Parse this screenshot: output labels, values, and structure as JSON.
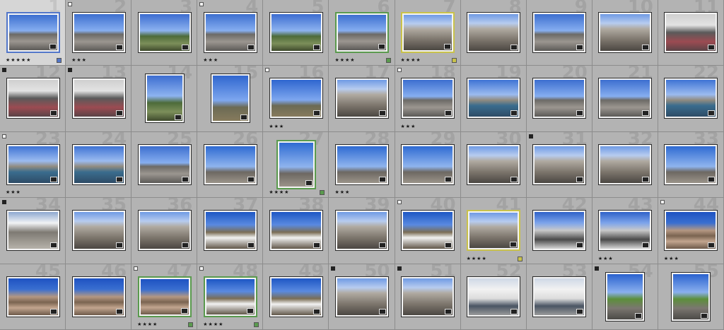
{
  "colors": {
    "grid_background": "#8f8f8f",
    "cell_background": "#b3b3b3",
    "cell_selected": "#d6d6d6",
    "label_green": "#5a9a4e",
    "label_yellow": "#c9c24a",
    "label_blue": "#5276c9"
  },
  "cells": [
    {
      "num": "1",
      "scene": "sky-town",
      "stars": "★★★★★",
      "flag": "none",
      "label": "blue",
      "orient": "landscape",
      "selected": true
    },
    {
      "num": "2",
      "scene": "sky-town",
      "stars": "★★★",
      "flag": "pick",
      "label": "none",
      "orient": "landscape"
    },
    {
      "num": "3",
      "scene": "sky-green",
      "stars": "",
      "flag": "none",
      "label": "none",
      "orient": "landscape"
    },
    {
      "num": "4",
      "scene": "sky-town",
      "stars": "★★★",
      "flag": "pick",
      "label": "none",
      "orient": "landscape"
    },
    {
      "num": "5",
      "scene": "sky-green",
      "stars": "",
      "flag": "none",
      "label": "none",
      "orient": "landscape"
    },
    {
      "num": "6",
      "scene": "sky-town",
      "stars": "★★★★",
      "flag": "none",
      "label": "green",
      "orient": "landscape"
    },
    {
      "num": "7",
      "scene": "buildings",
      "stars": "★★★★",
      "flag": "none",
      "label": "yellow",
      "orient": "landscape"
    },
    {
      "num": "8",
      "scene": "buildings",
      "stars": "",
      "flag": "none",
      "label": "none",
      "orient": "landscape"
    },
    {
      "num": "9",
      "scene": "sky-town",
      "stars": "",
      "flag": "none",
      "label": "none",
      "orient": "landscape"
    },
    {
      "num": "10",
      "scene": "buildings",
      "stars": "",
      "flag": "none",
      "label": "none",
      "orient": "landscape"
    },
    {
      "num": "11",
      "scene": "garage",
      "stars": "",
      "flag": "none",
      "label": "none",
      "orient": "landscape"
    },
    {
      "num": "12",
      "scene": "garage",
      "stars": "",
      "flag": "reject",
      "label": "none",
      "orient": "landscape"
    },
    {
      "num": "13",
      "scene": "garage",
      "stars": "",
      "flag": "reject",
      "label": "none",
      "orient": "landscape"
    },
    {
      "num": "14",
      "scene": "sky-green",
      "stars": "",
      "flag": "none",
      "label": "none",
      "orient": "portrait"
    },
    {
      "num": "15",
      "scene": "tower",
      "stars": "",
      "flag": "none",
      "label": "none",
      "orient": "portrait"
    },
    {
      "num": "16",
      "scene": "tower",
      "stars": "★★★",
      "flag": "pick",
      "label": "none",
      "orient": "landscape"
    },
    {
      "num": "17",
      "scene": "buildings",
      "stars": "",
      "flag": "none",
      "label": "none",
      "orient": "landscape"
    },
    {
      "num": "18",
      "scene": "sky-town",
      "stars": "★★★",
      "flag": "pick",
      "label": "none",
      "orient": "landscape"
    },
    {
      "num": "19",
      "scene": "harbor",
      "stars": "",
      "flag": "none",
      "label": "none",
      "orient": "landscape"
    },
    {
      "num": "20",
      "scene": "sky-town",
      "stars": "",
      "flag": "none",
      "label": "none",
      "orient": "landscape"
    },
    {
      "num": "21",
      "scene": "sky-town",
      "stars": "",
      "flag": "none",
      "label": "none",
      "orient": "landscape"
    },
    {
      "num": "22",
      "scene": "harbor",
      "stars": "",
      "flag": "none",
      "label": "none",
      "orient": "landscape"
    },
    {
      "num": "23",
      "scene": "harbor",
      "stars": "★★★",
      "flag": "pick",
      "label": "none",
      "orient": "landscape"
    },
    {
      "num": "24",
      "scene": "harbor",
      "stars": "",
      "flag": "none",
      "label": "none",
      "orient": "landscape"
    },
    {
      "num": "25",
      "scene": "sky-town",
      "stars": "",
      "flag": "none",
      "label": "none",
      "orient": "landscape"
    },
    {
      "num": "26",
      "scene": "crane",
      "stars": "",
      "flag": "none",
      "label": "none",
      "orient": "landscape"
    },
    {
      "num": "27",
      "scene": "crane",
      "stars": "★★★★",
      "flag": "none",
      "label": "green",
      "orient": "portrait"
    },
    {
      "num": "28",
      "scene": "crane",
      "stars": "★★★",
      "flag": "none",
      "label": "none",
      "orient": "landscape"
    },
    {
      "num": "29",
      "scene": "crane",
      "stars": "",
      "flag": "none",
      "label": "none",
      "orient": "landscape"
    },
    {
      "num": "30",
      "scene": "buildings",
      "stars": "",
      "flag": "none",
      "label": "none",
      "orient": "landscape"
    },
    {
      "num": "31",
      "scene": "buildings",
      "stars": "",
      "flag": "reject",
      "label": "none",
      "orient": "landscape"
    },
    {
      "num": "32",
      "scene": "buildings",
      "stars": "",
      "flag": "none",
      "label": "none",
      "orient": "landscape"
    },
    {
      "num": "33",
      "scene": "crane",
      "stars": "",
      "flag": "none",
      "label": "none",
      "orient": "landscape"
    },
    {
      "num": "34",
      "scene": "carpark",
      "stars": "",
      "flag": "reject",
      "label": "none",
      "orient": "landscape"
    },
    {
      "num": "35",
      "scene": "buildings",
      "stars": "",
      "flag": "none",
      "label": "none",
      "orient": "landscape"
    },
    {
      "num": "36",
      "scene": "buildings",
      "stars": "",
      "flag": "none",
      "label": "none",
      "orient": "landscape"
    },
    {
      "num": "37",
      "scene": "shed",
      "stars": "",
      "flag": "none",
      "label": "none",
      "orient": "landscape"
    },
    {
      "num": "38",
      "scene": "shed",
      "stars": "",
      "flag": "none",
      "label": "none",
      "orient": "landscape"
    },
    {
      "num": "39",
      "scene": "buildings",
      "stars": "",
      "flag": "none",
      "label": "none",
      "orient": "landscape"
    },
    {
      "num": "40",
      "scene": "shed",
      "stars": "",
      "flag": "pick",
      "label": "none",
      "orient": "landscape"
    },
    {
      "num": "41",
      "scene": "buildings",
      "stars": "★★★★",
      "flag": "none",
      "label": "yellow",
      "orient": "landscape"
    },
    {
      "num": "42",
      "scene": "rails",
      "stars": "",
      "flag": "none",
      "label": "none",
      "orient": "landscape"
    },
    {
      "num": "43",
      "scene": "rails",
      "stars": "★★★",
      "flag": "none",
      "label": "none",
      "orient": "landscape"
    },
    {
      "num": "44",
      "scene": "slats",
      "stars": "★★★",
      "flag": "pick",
      "label": "none",
      "orient": "landscape"
    },
    {
      "num": "45",
      "scene": "slats",
      "stars": "",
      "flag": "none",
      "label": "none",
      "orient": "landscape"
    },
    {
      "num": "46",
      "scene": "slats",
      "stars": "",
      "flag": "none",
      "label": "none",
      "orient": "landscape"
    },
    {
      "num": "47",
      "scene": "slats",
      "stars": "★★★★",
      "flag": "pick",
      "label": "green",
      "orient": "landscape"
    },
    {
      "num": "48",
      "scene": "shed",
      "stars": "★★★★",
      "flag": "pick",
      "label": "green",
      "orient": "landscape"
    },
    {
      "num": "49",
      "scene": "shed",
      "stars": "",
      "flag": "none",
      "label": "none",
      "orient": "landscape"
    },
    {
      "num": "50",
      "scene": "buildings",
      "stars": "",
      "flag": "reject",
      "label": "none",
      "orient": "landscape"
    },
    {
      "num": "51",
      "scene": "buildings",
      "stars": "",
      "flag": "reject",
      "label": "none",
      "orient": "landscape"
    },
    {
      "num": "52",
      "scene": "facade",
      "stars": "",
      "flag": "none",
      "label": "none",
      "orient": "landscape"
    },
    {
      "num": "53",
      "scene": "facade",
      "stars": "",
      "flag": "none",
      "label": "none",
      "orient": "landscape"
    },
    {
      "num": "54",
      "scene": "path",
      "stars": "",
      "flag": "reject",
      "label": "none",
      "orient": "portrait"
    },
    {
      "num": "55",
      "scene": "path",
      "stars": "",
      "flag": "none",
      "label": "none",
      "orient": "portrait"
    }
  ]
}
